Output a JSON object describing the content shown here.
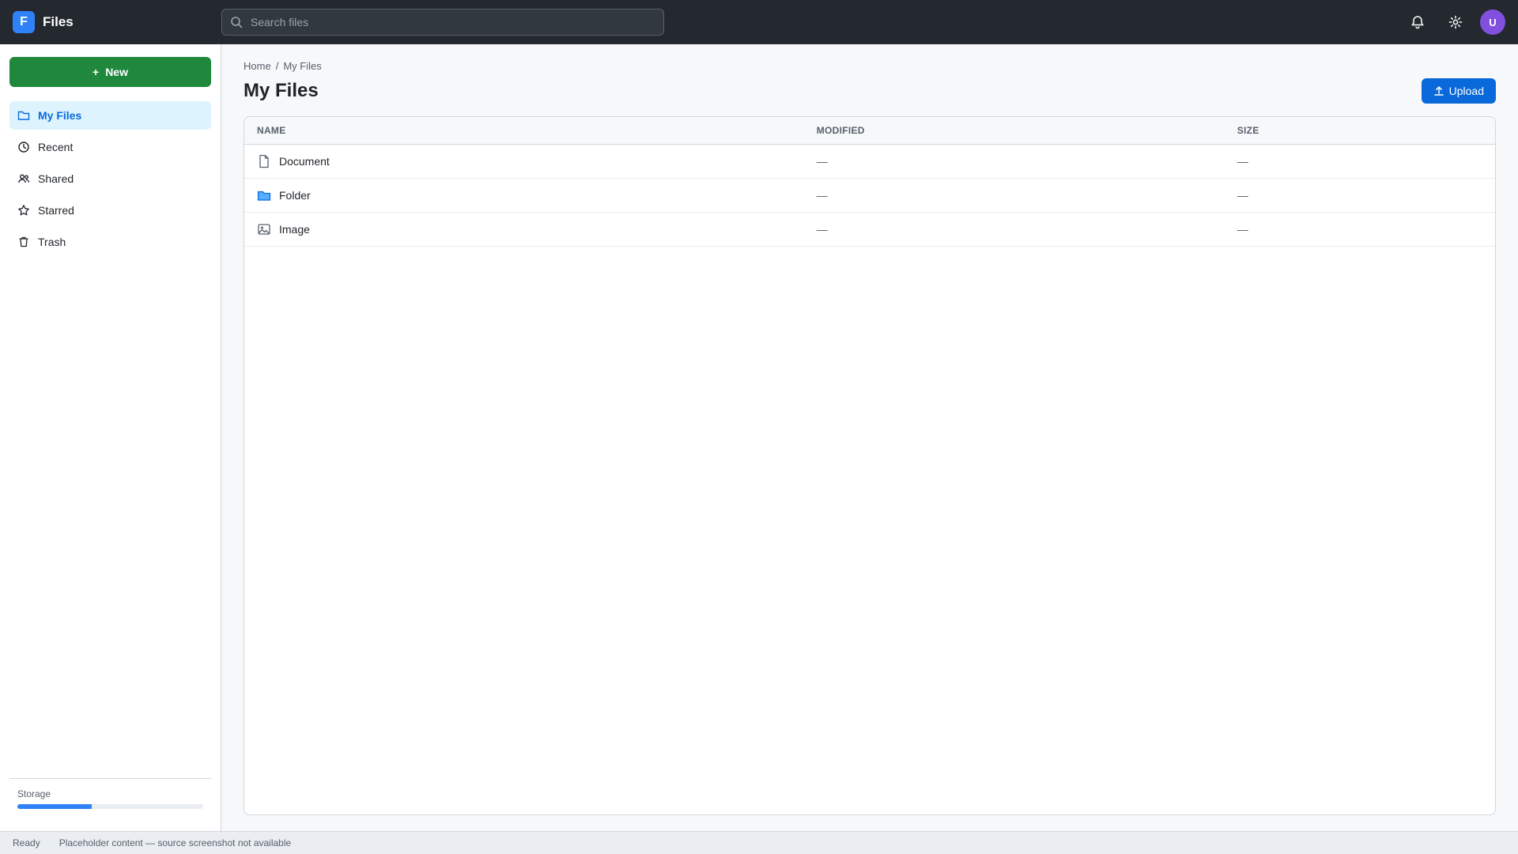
{
  "app": {
    "logo_letter": "F",
    "title": "Files"
  },
  "search": {
    "placeholder": "Search files"
  },
  "header": {
    "avatar_initials": "U"
  },
  "sidebar": {
    "new_label": "New",
    "items": [
      {
        "label": "My Files",
        "count": ""
      },
      {
        "label": "Recent",
        "count": ""
      },
      {
        "label": "Shared",
        "count": ""
      },
      {
        "label": "Starred",
        "count": ""
      },
      {
        "label": "Trash",
        "count": ""
      }
    ],
    "storage_label": "Storage",
    "storage_fraction": 0.4
  },
  "main": {
    "breadcrumb": [
      "Home",
      "My Files"
    ],
    "title": "My Files",
    "upload_label": "Upload",
    "columns": [
      "Name",
      "Modified",
      "Size"
    ],
    "rows": [
      {
        "name": "Document",
        "modified": "—",
        "size": "—",
        "type": "doc"
      },
      {
        "name": "Folder",
        "modified": "—",
        "size": "—",
        "type": "folder"
      },
      {
        "name": "Image",
        "modified": "—",
        "size": "—",
        "type": "image"
      }
    ]
  },
  "status": {
    "left": "Ready",
    "right": "Placeholder content — source screenshot not available"
  },
  "colors": {
    "accent": "#0969da",
    "header": "#24292f"
  }
}
